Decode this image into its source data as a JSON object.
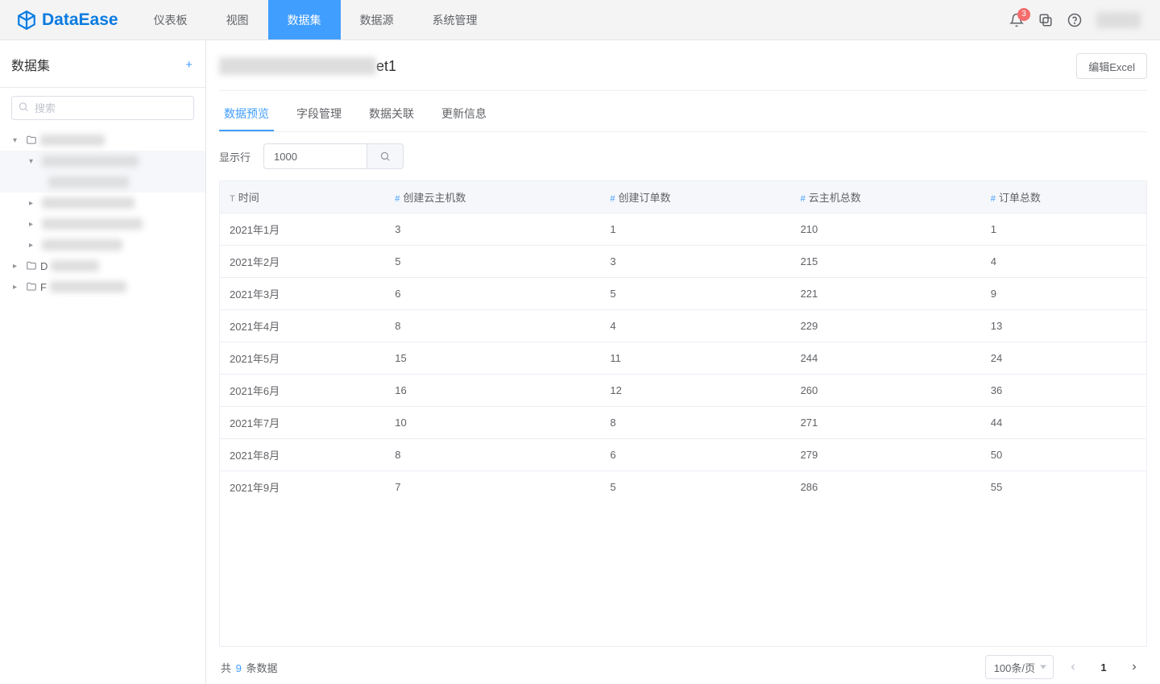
{
  "brand": "DataEase",
  "nav": {
    "items": [
      "仪表板",
      "视图",
      "数据集",
      "数据源",
      "系统管理"
    ],
    "active_index": 2
  },
  "topbar": {
    "badge_count": "3"
  },
  "sidebar": {
    "title": "数据集",
    "search_placeholder": "搜索"
  },
  "page": {
    "title_suffix": "et1",
    "edit_button": "编辑Excel"
  },
  "subTabs": {
    "items": [
      "数据预览",
      "字段管理",
      "数据关联",
      "更新信息"
    ],
    "active_index": 0
  },
  "rowControl": {
    "label": "显示行",
    "value": "1000"
  },
  "table": {
    "columns": [
      {
        "type": "text",
        "label": "时间"
      },
      {
        "type": "num",
        "label": "创建云主机数"
      },
      {
        "type": "num",
        "label": "创建订单数"
      },
      {
        "type": "num",
        "label": "云主机总数"
      },
      {
        "type": "num",
        "label": "订单总数"
      }
    ],
    "rows": [
      [
        "2021年1月",
        "3",
        "1",
        "210",
        "1"
      ],
      [
        "2021年2月",
        "5",
        "3",
        "215",
        "4"
      ],
      [
        "2021年3月",
        "6",
        "5",
        "221",
        "9"
      ],
      [
        "2021年4月",
        "8",
        "4",
        "229",
        "13"
      ],
      [
        "2021年5月",
        "15",
        "11",
        "244",
        "24"
      ],
      [
        "2021年6月",
        "16",
        "12",
        "260",
        "36"
      ],
      [
        "2021年7月",
        "10",
        "8",
        "271",
        "44"
      ],
      [
        "2021年8月",
        "8",
        "6",
        "279",
        "50"
      ],
      [
        "2021年9月",
        "7",
        "5",
        "286",
        "55"
      ]
    ]
  },
  "footer": {
    "prefix": "共 ",
    "count": "9",
    "suffix": " 条数据",
    "page_size": "100条/页",
    "current_page": "1"
  }
}
